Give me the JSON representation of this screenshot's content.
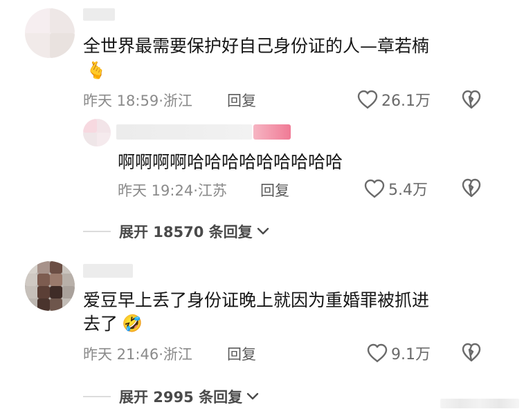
{
  "comments": [
    {
      "text": "全世界最需要保护好自己身份证的人—章若楠",
      "emoji": "🫰",
      "time": "昨天 18:59",
      "location": "浙江",
      "reply_label": "回复",
      "likes": "26.1万",
      "replies": [
        {
          "text": "啊啊啊啊哈哈哈哈哈哈哈哈哈",
          "time": "昨天 19:24",
          "location": "江苏",
          "reply_label": "回复",
          "likes": "5.4万"
        }
      ],
      "expand_label": "展开 18570 条回复"
    },
    {
      "text_line1": "爱豆早上丢了身份证晚上就因为重婚罪被抓进",
      "text_line2": "去了",
      "emoji": "🤣",
      "time": "昨天 21:46",
      "location": "浙江",
      "reply_label": "回复",
      "likes": "9.1万",
      "expand_label": "展开 2995 条回复"
    }
  ],
  "icons": {
    "like": "heart-outline-icon",
    "dislike": "broken-heart-icon",
    "expand": "chevron-down-icon"
  },
  "colors": {
    "meta": "#8a8a8a",
    "text": "#161616",
    "icon": "#6a6a6a"
  }
}
